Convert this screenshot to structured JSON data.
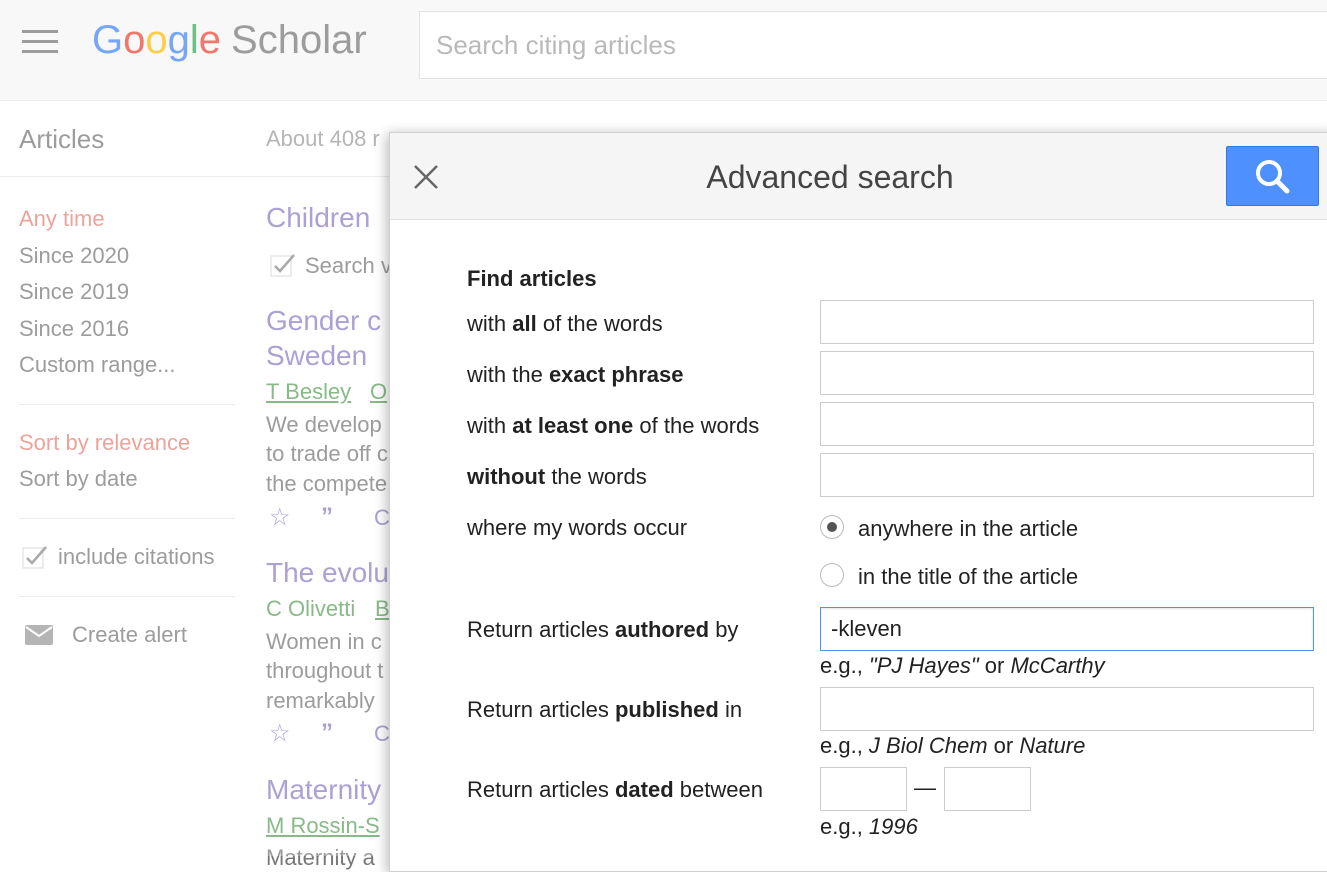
{
  "header": {
    "logo_google": "Google",
    "logo_scholar": "Scholar",
    "search_placeholder": "Search citing articles"
  },
  "sidebar": {
    "section_title": "Articles",
    "time_filters": [
      "Any time",
      "Since 2020",
      "Since 2019",
      "Since 2016",
      "Custom range..."
    ],
    "sort_options": [
      "Sort by relevance",
      "Sort by date"
    ],
    "include_citations": "include citations",
    "create_alert": "Create alert"
  },
  "results": {
    "stats": "About 408 r",
    "search_within_label": "Search v",
    "items": [
      {
        "title": "Children",
        "authors": "",
        "snippet": []
      },
      {
        "title_line1": "Gender c",
        "title_line2": "Sweden",
        "authors_a": "T Besley",
        "authors_b": "O",
        "snippet": [
          "We develop",
          "to trade off c",
          "the compete"
        ],
        "action_c": "C"
      },
      {
        "title": "The evolu",
        "authors_a": "C Olivetti",
        "authors_b": "B",
        "snippet": [
          "Women in c",
          "throughout t",
          "remarkably"
        ],
        "action_c": "C"
      },
      {
        "title": "Maternity",
        "authors_a": "M Rossin-S",
        "snippet": [
          "Maternity a"
        ]
      }
    ]
  },
  "dialog": {
    "title": "Advanced search",
    "find_articles": "Find articles",
    "rows": {
      "all_pre": "with ",
      "all_bold": "all",
      "all_post": " of the words",
      "exact_pre": "with the ",
      "exact_bold": "exact phrase",
      "least_pre": "with ",
      "least_bold": "at least one",
      "least_post": " of the words",
      "without_bold": "without",
      "without_post": " the words",
      "occur_label": "where my words occur",
      "radio_anywhere": "anywhere in the article",
      "radio_title": "in the title of the article",
      "author_pre": "Return articles ",
      "author_bold": "authored",
      "author_post": " by",
      "author_value": "-kleven",
      "author_hint_pre": "e.g., ",
      "author_hint_i1": "\"PJ Hayes\"",
      "author_hint_mid": " or ",
      "author_hint_i2": "McCarthy",
      "pub_pre": "Return articles ",
      "pub_bold": "published",
      "pub_post": " in",
      "pub_hint_pre": "e.g., ",
      "pub_hint_i1": "J Biol Chem",
      "pub_hint_mid": " or ",
      "pub_hint_i2": "Nature",
      "date_pre": "Return articles ",
      "date_bold": "dated",
      "date_post": " between",
      "date_dash": "—",
      "date_hint_pre": "e.g., ",
      "date_hint_i": "1996"
    },
    "selected_occurrence": "anywhere"
  },
  "colors": {
    "accent_blue": "#4d90fe",
    "active_red": "#dd4b39",
    "link_purple": "#8e7cc3",
    "author_green": "#5aa05a"
  }
}
